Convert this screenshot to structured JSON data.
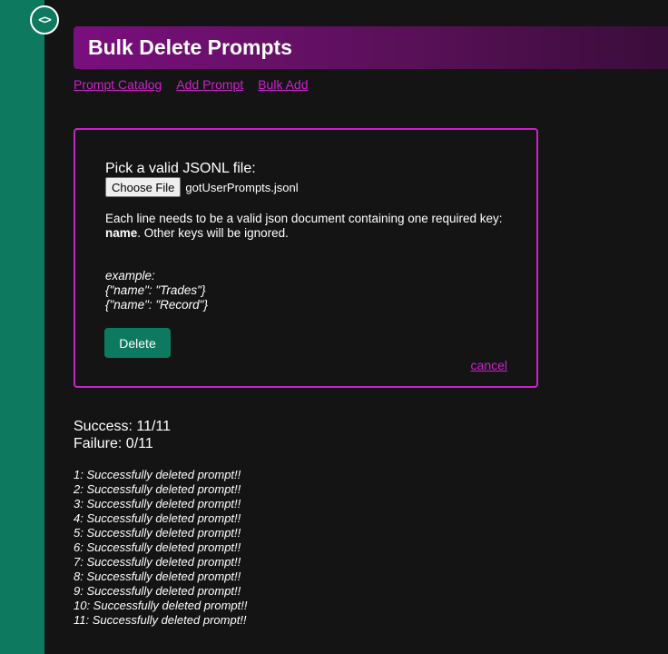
{
  "logo_glyph": "<>",
  "header": {
    "title": "Bulk Delete Prompts"
  },
  "nav": {
    "links": [
      "Prompt Catalog",
      "Add Prompt",
      "Bulk Add"
    ]
  },
  "form": {
    "pick_label": "Pick a valid JSONL file:",
    "choose_button": "Choose File",
    "file_name": "gotUserPrompts.jsonl",
    "desc_prefix": "Each line needs to be a valid json document containing one required key: ",
    "desc_key": "name",
    "desc_suffix": ". Other keys will be ignored.",
    "example_lines": [
      "example:",
      "{\"name\": \"Trades\"}",
      "{\"name\": \"Record\"}"
    ],
    "delete_button": "Delete",
    "cancel_link": "cancel"
  },
  "stats": {
    "success": "Success: 11/11",
    "failure": "Failure: 0/11"
  },
  "results": [
    "1: Successfully deleted prompt!!",
    "2: Successfully deleted prompt!!",
    "3: Successfully deleted prompt!!",
    "4: Successfully deleted prompt!!",
    "5: Successfully deleted prompt!!",
    "6: Successfully deleted prompt!!",
    "7: Successfully deleted prompt!!",
    "8: Successfully deleted prompt!!",
    "9: Successfully deleted prompt!!",
    "10: Successfully deleted prompt!!",
    "11: Successfully deleted prompt!!"
  ],
  "colors": {
    "sidebar": "#0d7a60",
    "accent": "#c625c6",
    "link": "#d11fd1",
    "background": "#141414"
  }
}
